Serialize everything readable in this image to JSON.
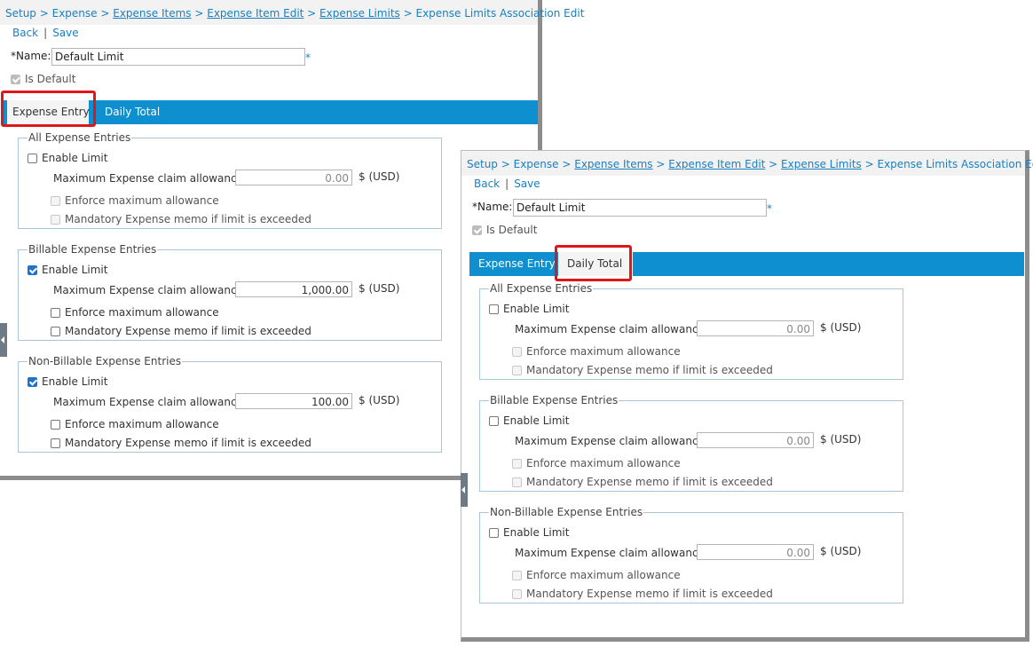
{
  "breadcrumb": {
    "setup": "Setup",
    "sep": " > ",
    "expense": "Expense",
    "expense_items": "Expense Items",
    "expense_item_edit": "Expense Item Edit",
    "expense_limits": "Expense Limits",
    "current": "Expense Limits Association Edit"
  },
  "actions": {
    "back": "Back",
    "separator": "|",
    "save": "Save"
  },
  "name_field": {
    "label": "*Name:",
    "value": "Default Limit",
    "required_marker": "*"
  },
  "is_default": {
    "label": "Is Default",
    "checked": true
  },
  "tabs": {
    "expense_entry": "Expense Entry",
    "daily_total": "Daily Total"
  },
  "labels": {
    "enable_limit": "Enable Limit",
    "max_allowance": "Maximum Expense claim allowance:",
    "currency": "$ (USD)",
    "enforce": "Enforce maximum allowance",
    "mandatory_memo": "Mandatory Expense memo if limit is exceeded"
  },
  "expense_entry_panel": {
    "active_tab": "Expense Entry",
    "groups": [
      {
        "title": "All Expense Entries",
        "enabled": false,
        "amount": "0.00"
      },
      {
        "title": "Billable Expense Entries",
        "enabled": true,
        "amount": "1,000.00"
      },
      {
        "title": "Non-Billable Expense Entries",
        "enabled": true,
        "amount": "100.00"
      }
    ]
  },
  "daily_total_panel": {
    "active_tab": "Daily Total",
    "groups": [
      {
        "title": "All Expense Entries",
        "enabled": false,
        "amount": "0.00"
      },
      {
        "title": "Billable Expense Entries",
        "enabled": false,
        "amount": "0.00"
      },
      {
        "title": "Non-Billable Expense Entries",
        "enabled": false,
        "amount": "0.00"
      }
    ]
  },
  "colors": {
    "link": "#1a7fc0",
    "tabbar": "#0e8fcf",
    "highlight": "#e0161b",
    "group_border": "#a9c6dc"
  }
}
